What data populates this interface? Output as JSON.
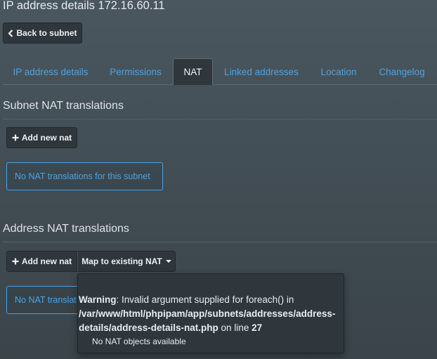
{
  "page": {
    "title": "IP address details 172.16.60.11",
    "back_label": "Back to subnet"
  },
  "tabs": [
    {
      "label": "IP address details",
      "active": false
    },
    {
      "label": "Permissions",
      "active": false
    },
    {
      "label": "NAT",
      "active": true
    },
    {
      "label": "Linked addresses",
      "active": false
    },
    {
      "label": "Location",
      "active": false
    },
    {
      "label": "Changelog",
      "active": false
    }
  ],
  "subnet_nat": {
    "title": "Subnet NAT translations",
    "add_label": "Add new nat",
    "empty_message": "No NAT translations for this subnet"
  },
  "address_nat": {
    "title": "Address NAT translations",
    "add_label": "Add new nat",
    "map_label": "Map to existing NAT",
    "empty_message_visible": "No NAT translat"
  },
  "dropdown": {
    "warning_label": "Warning",
    "warning_text": ": Invalid argument supplied for foreach() in",
    "warning_path": "/var/www/html/phpipam/app/subnets/addresses/address-details/address-details-nat.php",
    "warning_on_line": " on line ",
    "warning_line": "27",
    "item_label": "No NAT objects available"
  },
  "icons": {
    "back": "chevron-left-icon",
    "add": "plus-icon",
    "dropdown": "caret-down-icon"
  },
  "colors": {
    "link": "#4aa3e6",
    "button_bg": "#2f373c",
    "page_bg": "#45515a"
  }
}
